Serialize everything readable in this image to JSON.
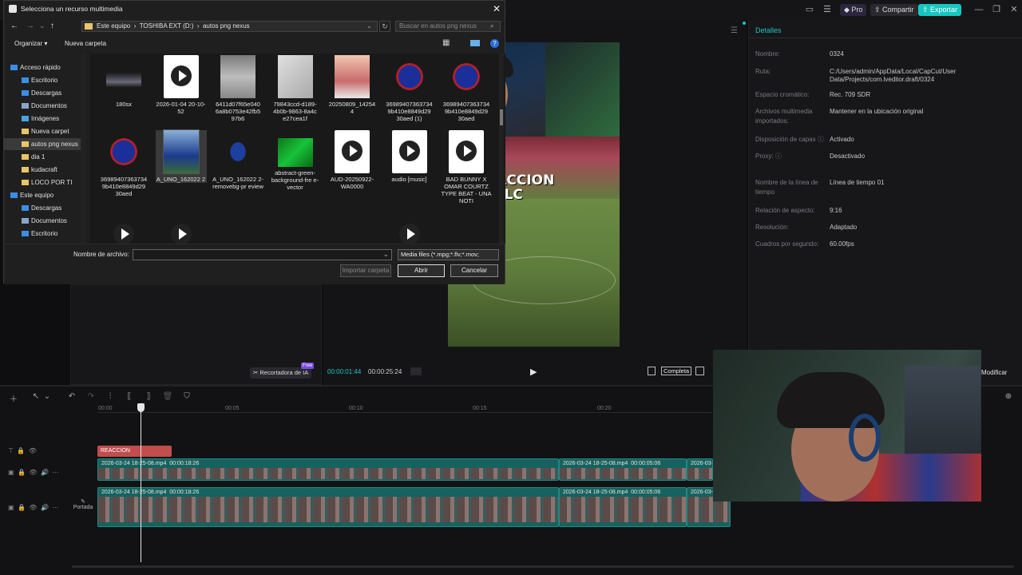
{
  "topbar": {
    "pro": "Pro",
    "share": "Compartir",
    "export": "Exportar"
  },
  "dialog": {
    "title": "Selecciona un recurso multimedia",
    "path": [
      "Este equipo",
      "TOSHIBA EXT (D:)",
      "autos png nexus"
    ],
    "search_placeholder": "Buscar en autos png nexus",
    "organize": "Organizar",
    "new_folder": "Nueva carpeta",
    "nav": [
      {
        "label": "Acceso rápido",
        "level": 0,
        "icon": "star"
      },
      {
        "label": "Escritorio",
        "level": 1,
        "icon": "desktop"
      },
      {
        "label": "Descargas",
        "level": 1,
        "icon": "download"
      },
      {
        "label": "Documentos",
        "level": 1,
        "icon": "docs"
      },
      {
        "label": "Imágenes",
        "level": 1,
        "icon": "images"
      },
      {
        "label": "Nueva carpet",
        "level": 1,
        "icon": "folder"
      },
      {
        "label": "autos png nexus",
        "level": 1,
        "icon": "folder"
      },
      {
        "label": "dia 1",
        "level": 1,
        "icon": "folder"
      },
      {
        "label": "kudacraft",
        "level": 1,
        "icon": "folder"
      },
      {
        "label": "LOCO POR TI",
        "level": 1,
        "icon": "folder"
      },
      {
        "label": "Este equipo",
        "level": 0,
        "icon": "pc"
      },
      {
        "label": "Descargas",
        "level": 1,
        "icon": "download"
      },
      {
        "label": "Documentos",
        "level": 1,
        "icon": "docs"
      },
      {
        "label": "Escritorio",
        "level": 1,
        "icon": "desktop"
      }
    ],
    "files_row1": [
      {
        "name": "180sx",
        "kind": "car"
      },
      {
        "name": "2026-01-04 20-10-52",
        "kind": "video"
      },
      {
        "name": "6411d07f65e040 6a8b0753e42fb5 97b6",
        "kind": "statue"
      },
      {
        "name": "79843ccd-d189-4b0b-9863-8a4c e27cea1f",
        "kind": "card"
      },
      {
        "name": "20250809_14254 4",
        "kind": "person"
      },
      {
        "name": "36989407363734 9b410e8849d29 30aed (1)",
        "kind": "logo"
      },
      {
        "name": "36989407363734 9b410e8849d29 30aed",
        "kind": "logo"
      }
    ],
    "files_row2": [
      {
        "name": "36989407363734 9b410e8849d29 30aed",
        "kind": "logo"
      },
      {
        "name": "A_UNO_162022 2",
        "kind": "team"
      },
      {
        "name": "A_UNO_162022 2-removebg-pr eview",
        "kind": "player"
      },
      {
        "name": "abstract-green-background-fre e-vector",
        "kind": "green"
      },
      {
        "name": "AUD-20250922-WA0000",
        "kind": "video"
      },
      {
        "name": "audio [music]",
        "kind": "video"
      },
      {
        "name": "BAD BUNNY X OMAR COURTZ TYPE BEAT - UNA NOTI",
        "kind": "video"
      }
    ],
    "filename_label": "Nombre de archivo:",
    "filetype": "Media files (*.mpg;*.flv;*.mov;",
    "import_folder": "Importar carpeta",
    "open": "Abrir",
    "cancel": "Cancelar"
  },
  "media": {
    "ai_cutout": "Recortadora de IA",
    "badge": "Free"
  },
  "player": {
    "current": "00:00:01:44",
    "total": "00:00:25:24",
    "overlay": "REACCION\nH 0-1 ULC",
    "ratio_btn": "Completa",
    "modify": "Modificar"
  },
  "details": {
    "header": "Detalles",
    "rows": [
      {
        "label": "Nombre:",
        "value": "0324"
      },
      {
        "label": "Ruta:",
        "value": "C:/Users/admin/AppData/Local/CapCut/User Data/Projects/com.lveditor.draft/0324"
      },
      {
        "label": "Espacio cromático:",
        "value": "Rec. 709 SDR"
      },
      {
        "label": "Archivos multimedia importados:",
        "value": "Mantener en la ubicación original"
      },
      {
        "label": "Disposición de capas ⓘ",
        "value": "Activado"
      },
      {
        "label": "Proxy: ⓘ",
        "value": "Desactivado"
      },
      {
        "label": "Nombre de la línea de tiempo",
        "value": "Línea de tiempo 01"
      },
      {
        "label": "Relación de aspecto:",
        "value": "9:16"
      },
      {
        "label": "Resolución:",
        "value": "Adaptado"
      },
      {
        "label": "Cuadros por segundo:",
        "value": "60.00fps"
      }
    ]
  },
  "timeline": {
    "ticks": [
      "00:00",
      "00:05",
      "00:10",
      "00:15",
      "00:20"
    ],
    "text_clip": "REACCION",
    "clip1_name": "2026-03-24 18-25-08.mp4",
    "clip1_dur": "00:00:18:26",
    "clip2_name": "2026-03-24 18-25-08.mp4",
    "clip2_dur": "00:00:05:06",
    "clip3_name": "2026-03-2",
    "cover": "Portada"
  }
}
